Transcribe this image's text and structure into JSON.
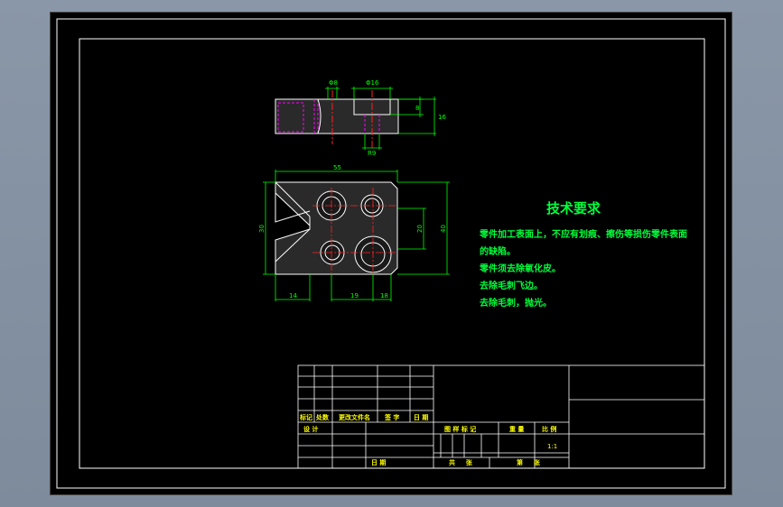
{
  "drawing": {
    "colors": {
      "background": "#000000",
      "outline": "#ffffff",
      "dimension": "#00ff00",
      "centerline": "#ff2020",
      "hidden": "#ff00ff",
      "text": "#00ff3c"
    },
    "top_view_dims": {
      "d_left": "Φ8",
      "d_mid": "Φ16",
      "h_small": "8",
      "h_total": "16",
      "w_bottom": "R9"
    },
    "front_view_dims": {
      "width_total": "55",
      "height_left": "30",
      "height_right": "40",
      "height_mid": "20",
      "bottom_left": "14",
      "bottom_mid": "19",
      "bottom_right": "18"
    }
  },
  "tech_requirements": {
    "title": "技术要求",
    "lines": [
      "零件加工表面上，不应有划痕、擦伤等损伤零件表面",
      "的缺陷。",
      "零件须去除氧化皮。",
      "去除毛刺飞边。",
      "去除毛刺，抛光。"
    ]
  },
  "title_block": {
    "rev_row": [
      "标记",
      "处数",
      "更改文件名",
      "签 字",
      "日 期"
    ],
    "design": "设 计",
    "date": "日 期",
    "stage_headers": [
      "图 样 标 记",
      "重 量",
      "比 例"
    ],
    "scale": "1:1",
    "sheet_total": "共 　 张",
    "sheet_no": "第 　 张"
  }
}
